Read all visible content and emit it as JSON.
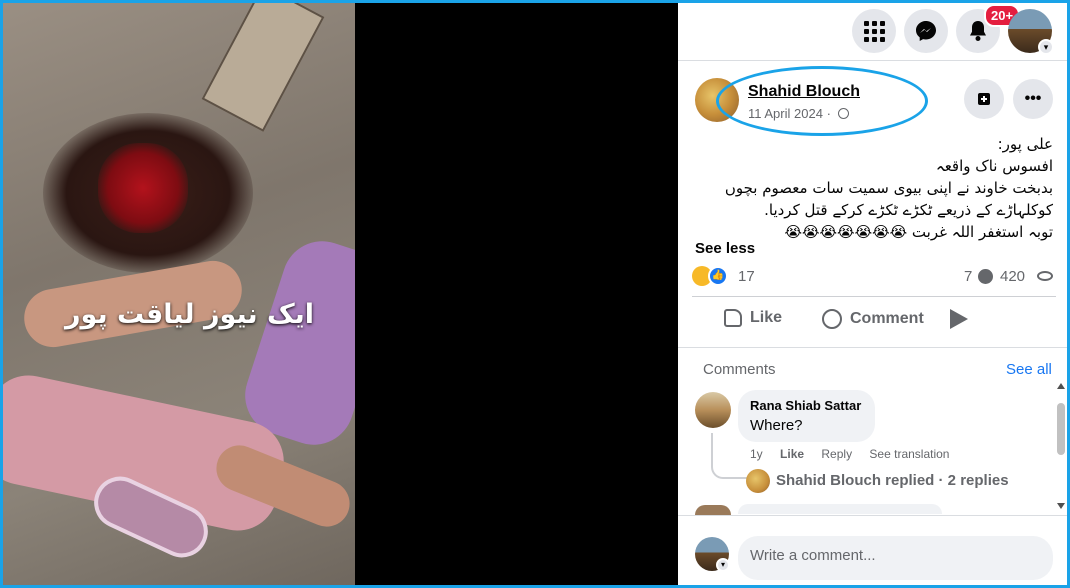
{
  "video": {
    "overlay_text": "ایک نیوز لیاقت پور"
  },
  "topbar": {
    "menu_icon": "grid-menu-icon",
    "messenger_icon": "messenger-icon",
    "notifications_icon": "bell-icon",
    "notification_badge": "20+",
    "account_icon": "account-avatar"
  },
  "post": {
    "author": "Shahid Blouch",
    "date": "11 April 2024",
    "date_separator": "·",
    "lines": [
      "علی پور:",
      "افسوس ناک واقعہ",
      "بدبخت خاوند نے اپنی بیوی سمیت سات معصوم بچوں",
      "کوکلہاڑے کے ذریعے ٹکڑے ٹکڑے کرکے قتل کردیا.",
      "توبہ استغفر اللہ غربت 😭😭😭😭😭😭😭"
    ],
    "see_less": "See less",
    "reaction_count": "17",
    "comment_count": "7",
    "view_count": "420"
  },
  "actions": {
    "like": "Like",
    "comment": "Comment"
  },
  "comments": {
    "label": "Comments",
    "see_all": "See all",
    "items": [
      {
        "name": "Rana Shiab Sattar",
        "text": "Where?",
        "time": "1y",
        "like": "Like",
        "reply": "Reply",
        "translate": "See translation",
        "replies_summary": "Shahid Blouch replied · 2 replies"
      }
    ]
  },
  "composer": {
    "placeholder": "Write a comment..."
  },
  "colors": {
    "highlight": "#1aa3e8",
    "brand_blue": "#1877f2",
    "badge_red": "#e41e3f"
  }
}
